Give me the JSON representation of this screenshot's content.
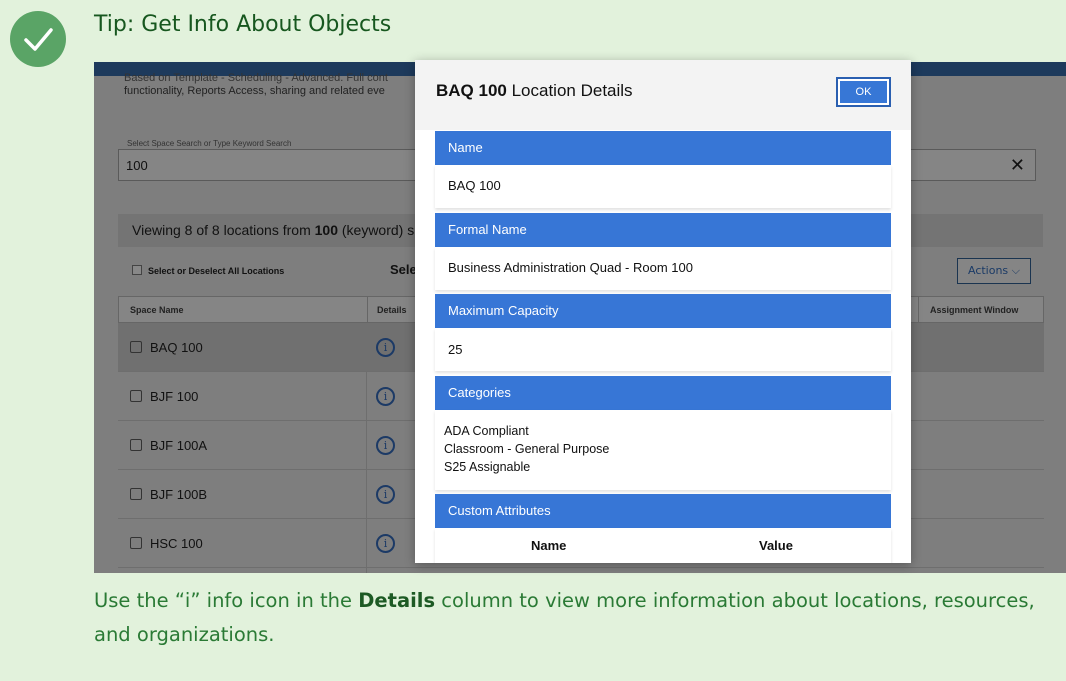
{
  "tip": {
    "title": "Tip: Get Info About Objects",
    "check_icon": "checkmark-icon",
    "caption_before": "Use the “i” info icon in the ",
    "caption_bold": "Details",
    "caption_after": " column to view more information about locations, resources, and organizations."
  },
  "background": {
    "desc_line1": "Based on Template - Scheduling - Advanced. Full cont",
    "desc_line2": "functionality, Reports Access, sharing and related eve",
    "search_label": "Select Space Search or Type Keyword Search",
    "search_value": "100",
    "clear_icon": "✕",
    "viewing_prefix": "Viewing 8 of 8 locations from ",
    "viewing_keyword": "100",
    "viewing_suffix": " (keyword) s",
    "select_all_label": "Select or Deselect All Locations",
    "sele_label": "Sele",
    "actions_label": "Actions",
    "columns": {
      "space_name": "Space Name",
      "details": "Details",
      "assignment_window": "Assignment Window"
    },
    "rows": [
      {
        "name": "BAQ 100"
      },
      {
        "name": "BJF 100"
      },
      {
        "name": "BJF 100A"
      },
      {
        "name": "BJF 100B"
      },
      {
        "name": "HSC 100"
      }
    ],
    "info_glyph": "i"
  },
  "modal": {
    "title_bold": "BAQ 100",
    "title_rest": " Location Details",
    "ok_label": "OK",
    "sections": {
      "name_label": "Name",
      "name_value": "BAQ 100",
      "formal_label": "Formal Name",
      "formal_value": "Business Administration Quad - Room 100",
      "capacity_label": "Maximum Capacity",
      "capacity_value": "25",
      "categories_label": "Categories",
      "categories": [
        "ADA Compliant",
        "Classroom - General Purpose",
        "S25 Assignable"
      ],
      "custom_label": "Custom Attributes",
      "custom_col_name": "Name",
      "custom_col_value": "Value"
    }
  },
  "colors": {
    "page_bg": "#e2f2dc",
    "check_green": "#5aa466",
    "title_green": "#17571f",
    "section_blue": "#3776d6",
    "caption_green": "#2a7a35"
  }
}
